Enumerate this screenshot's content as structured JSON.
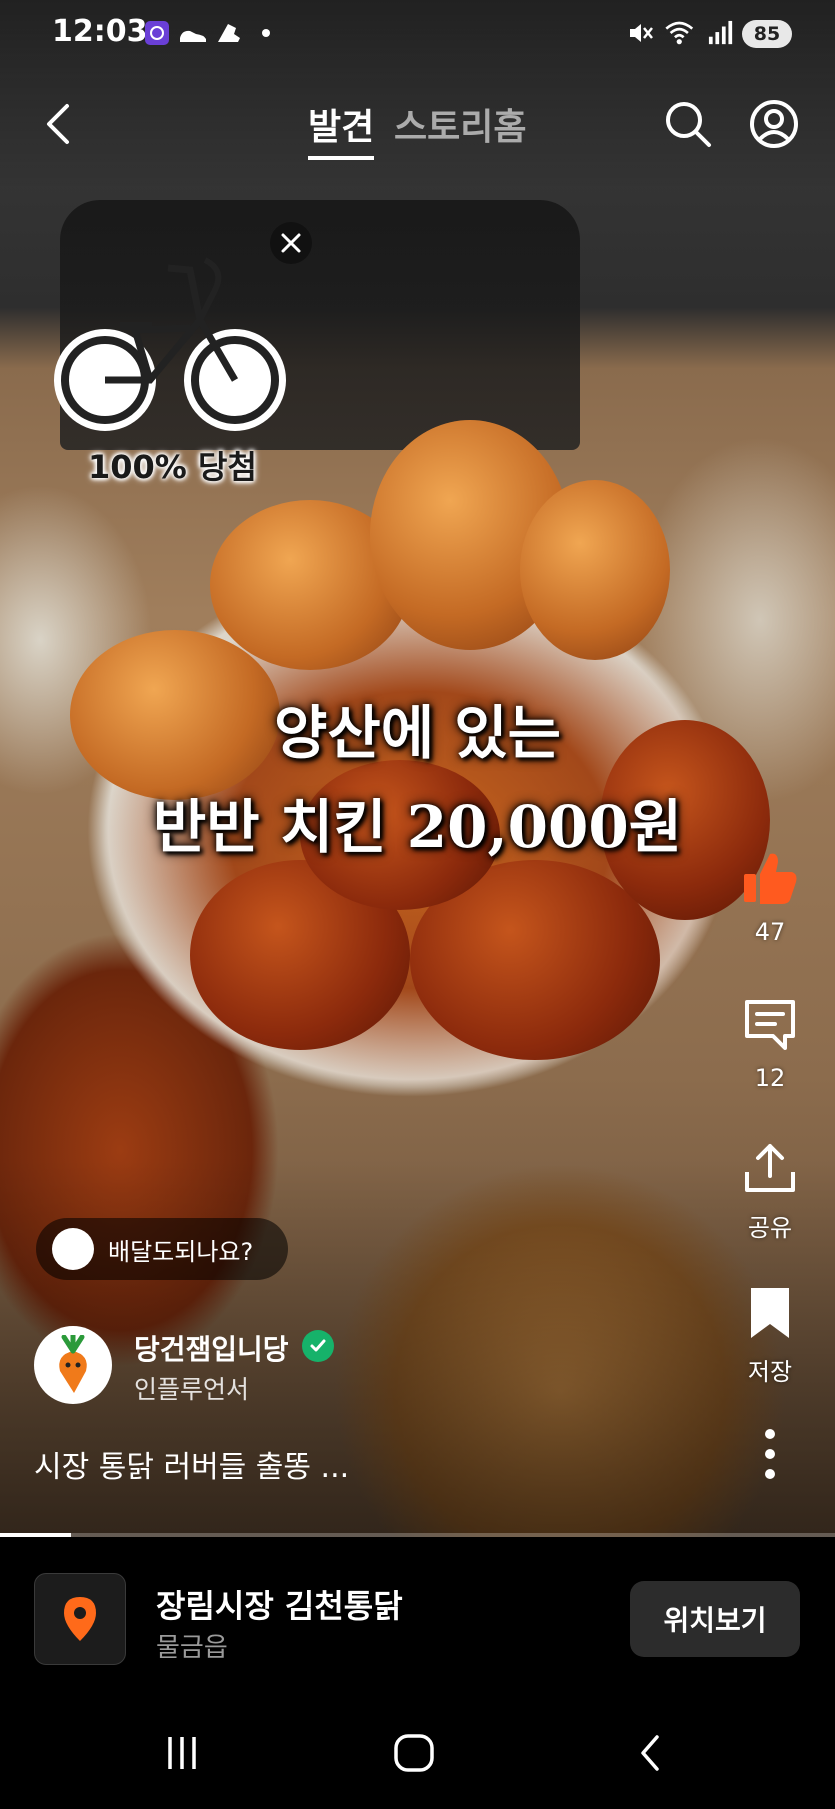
{
  "status_bar": {
    "time": "12:03",
    "battery": "85",
    "icons": [
      "app-notification-icon",
      "shoe-icon",
      "sneaker-icon",
      "dot-icon",
      "mute-icon",
      "wifi-icon",
      "signal-icon"
    ]
  },
  "top_nav": {
    "back_icon": "back-arrow-icon",
    "tabs": [
      {
        "label": "발견",
        "active": true
      },
      {
        "label": "스토리홈",
        "active": false
      }
    ],
    "search_icon": "search-icon",
    "profile_icon": "profile-icon"
  },
  "promo": {
    "label": "100% 당첨",
    "image": "bicycle-icon",
    "close_icon": "close-icon"
  },
  "caption_overlay": {
    "line1": "양산에 있는",
    "line2": "반반 치킨 20,000원"
  },
  "actions": {
    "like": {
      "icon": "thumbs-up-icon",
      "count": "47",
      "color": "#ff5a1f"
    },
    "comment": {
      "icon": "comment-icon",
      "count": "12"
    },
    "share": {
      "icon": "share-icon",
      "label": "공유"
    },
    "save": {
      "icon": "bookmark-icon",
      "label": "저장"
    },
    "more": {
      "icon": "more-vertical-icon"
    }
  },
  "question_chip": {
    "text": "배달도되나요?"
  },
  "author": {
    "name": "당건잼입니당",
    "role": "인플루언서",
    "verified": true
  },
  "description": "시장 통닭 러버들 출똥 ...",
  "progress": {
    "fraction": 0.085
  },
  "location": {
    "name": "장림시장 김천통닭",
    "sub": "물금읍",
    "button": "위치보기",
    "icon": "location-pin-icon",
    "accent": "#ff6a1a"
  },
  "system_nav": {
    "icons": [
      "recent-apps-icon",
      "home-icon",
      "back-icon"
    ]
  }
}
